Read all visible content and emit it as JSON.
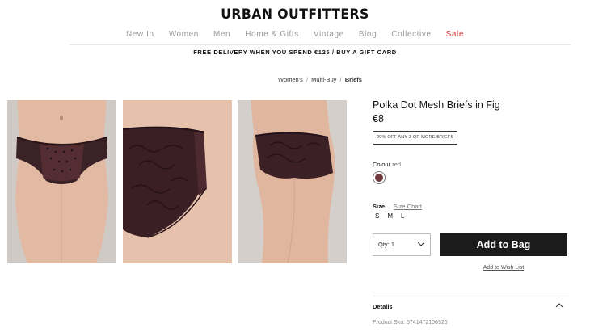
{
  "header": {
    "logo": "URBAN OUTFITTERS",
    "nav": [
      "New In",
      "Women",
      "Men",
      "Home & Gifts",
      "Vintage",
      "Blog",
      "Collective",
      "Sale"
    ],
    "promo_delivery": "FREE DELIVERY WHEN YOU SPEND €125",
    "promo_separator": "/",
    "promo_gift": "BUY A GIFT CARD",
    "sale_color": "#e0343a"
  },
  "breadcrumb": {
    "items": [
      "Women's",
      "Multi-Buy",
      "Briefs"
    ],
    "separator": "/"
  },
  "gallery": {
    "images": [
      {
        "icon": "model-front-photo"
      },
      {
        "icon": "model-back-closeup-photo"
      },
      {
        "icon": "model-side-photo"
      }
    ]
  },
  "product": {
    "title": "Polka Dot Mesh Briefs in Fig",
    "price": "€8",
    "offer": "20% OFF ANY 3 OR MORE BRIEFS",
    "colour_label": "Colour",
    "colour_value": "red",
    "swatch_color": "#6e3a3e",
    "size_label": "Size",
    "size_chart": "Size Chart",
    "sizes": [
      "S",
      "M",
      "L"
    ],
    "quantity": "Qty: 1",
    "add_to_bag": "Add to Bag",
    "wish_list": "Add to Wish List",
    "details_label": "Details",
    "sku": "Product Sku: 5741472106926"
  }
}
